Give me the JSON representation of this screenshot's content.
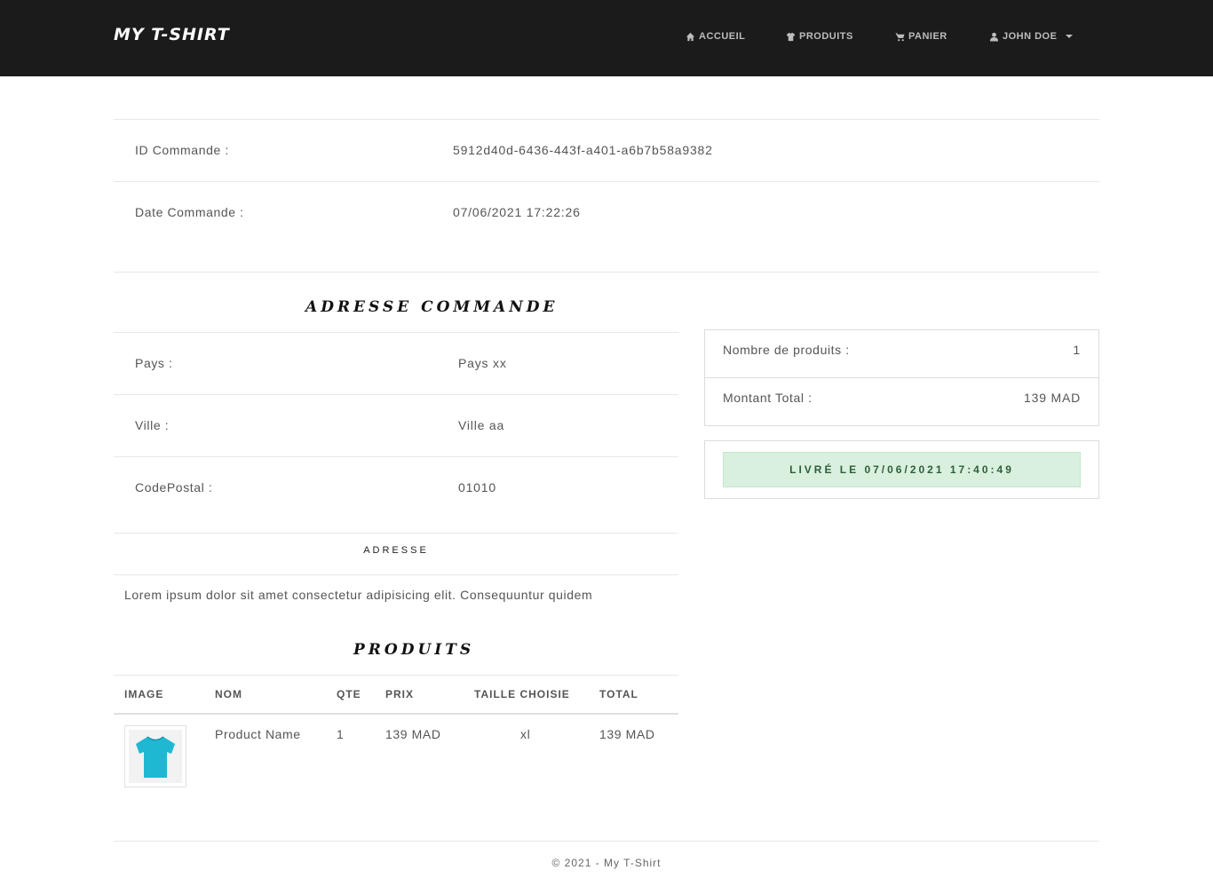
{
  "navbar": {
    "brand": "MY T-SHIRT",
    "items": [
      {
        "label": "ACCUEIL",
        "icon": "home-icon"
      },
      {
        "label": "PRODUITS",
        "icon": "tshirt-icon"
      },
      {
        "label": "PANIER",
        "icon": "cart-icon"
      },
      {
        "label": "JOHN DOE",
        "icon": "user-icon"
      }
    ]
  },
  "order": {
    "id_label": "ID Commande :",
    "id_value": "5912d40d-6436-443f-a401-a6b7b58a9382",
    "date_label": "Date Commande :",
    "date_value": "07/06/2021 17:22:26"
  },
  "address": {
    "title": "ADRESSE COMMANDE",
    "pays_label": "Pays :",
    "pays_value": "Pays xx",
    "ville_label": "Ville :",
    "ville_value": "Ville aa",
    "cp_label": "CodePostal :",
    "cp_value": "01010",
    "adresse_heading": "ADRESSE",
    "adresse_text": "Lorem ipsum dolor sit amet consectetur adipisicing elit. Consequuntur quidem"
  },
  "summary": {
    "nb_label": "Nombre de produits :",
    "nb_value": "1",
    "total_label": "Montant Total :",
    "total_value": "139 MAD",
    "status": "LIVRÉ LE 07/06/2021 17:40:49"
  },
  "products": {
    "title": "PRODUITS",
    "headers": [
      "IMAGE",
      "NOM",
      "QTE",
      "PRIX",
      "TAILLE CHOISIE",
      "TOTAL"
    ],
    "rows": [
      {
        "name": "Product Name",
        "qty": "1",
        "price": "139 MAD",
        "size": "xl",
        "total": "139 MAD"
      }
    ]
  },
  "footer": {
    "text": "© 2021 - My T-Shirt"
  },
  "colors": {
    "navbar": "#1b1b1b",
    "status_bg": "#d9f0df",
    "tshirt": "#1fb8d3"
  }
}
